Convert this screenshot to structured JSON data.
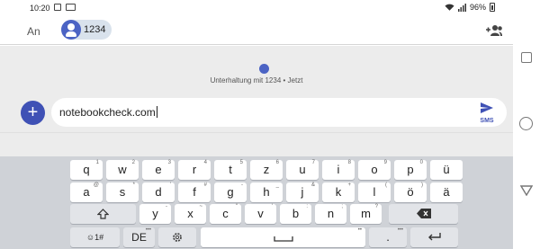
{
  "status_bar": {
    "time": "10:20",
    "battery": "96%"
  },
  "header": {
    "to_label": "An",
    "recipient": "1234"
  },
  "conversation": {
    "info": "Unterhaltung mit 1234 • Jetzt"
  },
  "compose": {
    "text": "notebookcheck.com",
    "send_label": "SMS"
  },
  "keyboard": {
    "row1": [
      {
        "k": "q",
        "h": "1"
      },
      {
        "k": "w",
        "h": "2"
      },
      {
        "k": "e",
        "h": "3"
      },
      {
        "k": "r",
        "h": "4"
      },
      {
        "k": "t",
        "h": "5"
      },
      {
        "k": "z",
        "h": "6"
      },
      {
        "k": "u",
        "h": "7"
      },
      {
        "k": "i",
        "h": "8"
      },
      {
        "k": "o",
        "h": "9"
      },
      {
        "k": "p",
        "h": "0"
      },
      {
        "k": "ü",
        "h": ""
      }
    ],
    "row2": [
      {
        "k": "a",
        "h": "@"
      },
      {
        "k": "s",
        "h": "*"
      },
      {
        "k": "d",
        "h": "'"
      },
      {
        "k": "f",
        "h": "#"
      },
      {
        "k": "g",
        "h": "-"
      },
      {
        "k": "h",
        "h": "_"
      },
      {
        "k": "j",
        "h": "&"
      },
      {
        "k": "k",
        "h": "+"
      },
      {
        "k": "l",
        "h": "("
      },
      {
        "k": "ö",
        "h": ")"
      },
      {
        "k": "ä",
        "h": ""
      }
    ],
    "row3": [
      {
        "k": "y",
        "h": "-"
      },
      {
        "k": "x",
        "h": "~"
      },
      {
        "k": "c",
        "h": "\""
      },
      {
        "k": "v",
        "h": "'"
      },
      {
        "k": "b",
        "h": ":"
      },
      {
        "k": "n",
        "h": ";"
      },
      {
        "k": "m",
        "h": "?"
      }
    ],
    "symbols_label": "☺1#",
    "language_label": "DE",
    "comma": ",",
    "period": "."
  }
}
